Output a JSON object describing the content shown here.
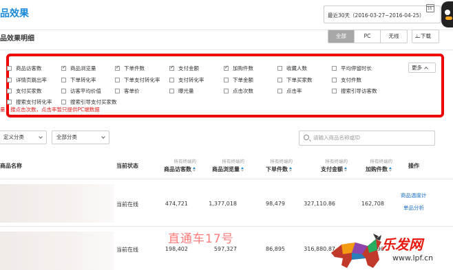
{
  "header": {
    "title": "品效果",
    "date_range": "最近30天（2016-03-27~2016-04-25）"
  },
  "section": {
    "title": "品效果明细",
    "device_tabs": [
      {
        "label": "全部",
        "active": true
      },
      {
        "label": "PC",
        "active": false
      },
      {
        "label": "无线",
        "active": false
      }
    ],
    "download_label": "下载"
  },
  "metrics": {
    "more_label": "更多",
    "note": "量，搜点击次数，点击率暂只提供PC端数据",
    "items": [
      {
        "label": "商品访客数",
        "checked": false
      },
      {
        "label": "商品浏览量",
        "checked": true
      },
      {
        "label": "下单件数",
        "checked": true
      },
      {
        "label": "支付金额",
        "checked": true
      },
      {
        "label": "加购件数",
        "checked": true
      },
      {
        "label": "收藏人数",
        "checked": false
      },
      {
        "label": "平均停留时长",
        "checked": false
      },
      {
        "label": "详情页跳出率",
        "checked": false
      },
      {
        "label": "下单转化率",
        "checked": false
      },
      {
        "label": "下单支付转化率",
        "checked": false
      },
      {
        "label": "支付转化率",
        "checked": false
      },
      {
        "label": "下单金额",
        "checked": false
      },
      {
        "label": "下单买家数",
        "checked": false
      },
      {
        "label": "支付件数",
        "checked": false
      },
      {
        "label": "支付买家数",
        "checked": false
      },
      {
        "label": "访客平均价值",
        "checked": false
      },
      {
        "label": "客单价",
        "checked": false
      },
      {
        "label": "曝光量",
        "checked": false
      },
      {
        "label": "点击次数",
        "checked": false
      },
      {
        "label": "点击率",
        "checked": false
      },
      {
        "label": "搜索引导访客数",
        "checked": false
      },
      {
        "label": "搜索支付转化率",
        "checked": false
      },
      {
        "label": "搜索引导支付买家数",
        "checked": false
      }
    ]
  },
  "filters": {
    "custom_category": "定义分类",
    "all_category": "全部分类",
    "search_placeholder": "请输入商品名称或ID"
  },
  "table": {
    "headers": {
      "name": "商品名称",
      "status": "当前状态",
      "sub": "所有终端的",
      "visitors": "商品访客数",
      "views": "商品浏览量",
      "orders": "下单件数",
      "payment": "支付金额",
      "cart": "加购件数",
      "action": "操作"
    },
    "rows": [
      {
        "status": "当前在线",
        "visitors": "474,721",
        "views": "1,377,018",
        "orders": "98,479",
        "payment": "327,110.86",
        "cart": "162,708",
        "ops": [
          "商品温度计",
          "单品分析"
        ]
      },
      {
        "status": "当前在线",
        "visitors": "198,402",
        "views": "597,327",
        "orders": "86,895",
        "payment": "316,880.87",
        "cart": "790",
        "ops": []
      }
    ]
  },
  "watermark": {
    "caption": "直通车17号",
    "logo_text": "乐发网",
    "logo_url": "www.lpf.cn"
  }
}
